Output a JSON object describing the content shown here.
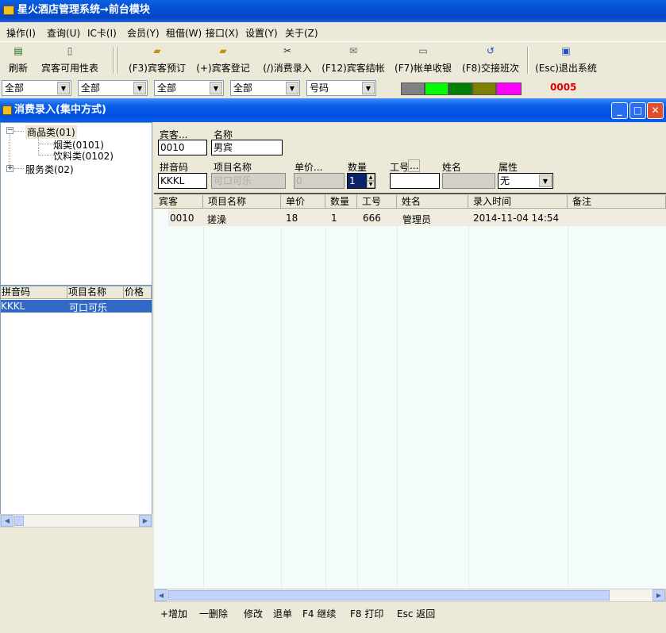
{
  "app": {
    "title": "星火酒店管理系统→前台模块"
  },
  "menu": [
    "操作(I)",
    "查询(U)",
    "IC卡(I)",
    "会员(Y)",
    "租借(W)",
    "接口(X)",
    "设置(Y)",
    "关于(Z)"
  ],
  "toolbar": [
    {
      "label": "刷新",
      "icon": "refresh-icon"
    },
    {
      "label": "宾客可用性表",
      "icon": "table-icon"
    },
    {
      "label": "(F3)宾客预订",
      "icon": "folder-icon"
    },
    {
      "label": "(+)宾客登记",
      "icon": "folder-icon"
    },
    {
      "label": "(/)消费录入",
      "icon": "scissors-icon"
    },
    {
      "label": "(F12)宾客结帐",
      "icon": "envelope-icon"
    },
    {
      "label": "(F7)帐单收银",
      "icon": "printer-icon"
    },
    {
      "label": "(F8)交接班次",
      "icon": "undo-icon"
    },
    {
      "label": "(Esc)退出系统",
      "icon": "exit-icon"
    }
  ],
  "filters": [
    "全部",
    "全部",
    "全部",
    "全部",
    "号码"
  ],
  "status_colors": [
    "#808080",
    "#00ff00",
    "#008000",
    "#808000",
    "#ff00ff"
  ],
  "status_code": "0005",
  "child": {
    "title": "消费录入(集中方式)"
  },
  "tree": {
    "nodes": [
      "商品类(01)",
      "烟类(0101)",
      "饮料类(0102)",
      "服务类(02)"
    ]
  },
  "left_list": {
    "headers": [
      "拼音码",
      "项目名称",
      "价格"
    ],
    "row": [
      "KKKL",
      "可口可乐",
      ""
    ]
  },
  "form": {
    "guest_label": "宾客...",
    "name_label": "名称",
    "guest_value": "0010",
    "name_value": "男宾",
    "pinyin_label": "拼音码",
    "item_label": "项目名称",
    "price_label": "单价...",
    "qty_label": "数量",
    "worker_label": "工号",
    "worker_btn": "...",
    "person_label": "姓名",
    "attr_label": "属性",
    "pinyin_value": "KKKL",
    "item_value": "可口可乐",
    "price_value": "0",
    "qty_value": "1",
    "worker_value": "",
    "person_value": "",
    "attr_value": "无"
  },
  "grid": {
    "headers": [
      "宾客",
      "项目名称",
      "单价",
      "数量",
      "工号",
      "姓名",
      "录入时间",
      "备注"
    ],
    "row": [
      "0010",
      "搓澡",
      "18",
      "1",
      "666",
      "管理员",
      "2014-11-04 14:54",
      ""
    ]
  },
  "bottom": [
    "+增加",
    "一删除",
    "修改",
    "退单",
    "F4 继续",
    "F8 打印",
    "Esc 返回"
  ]
}
